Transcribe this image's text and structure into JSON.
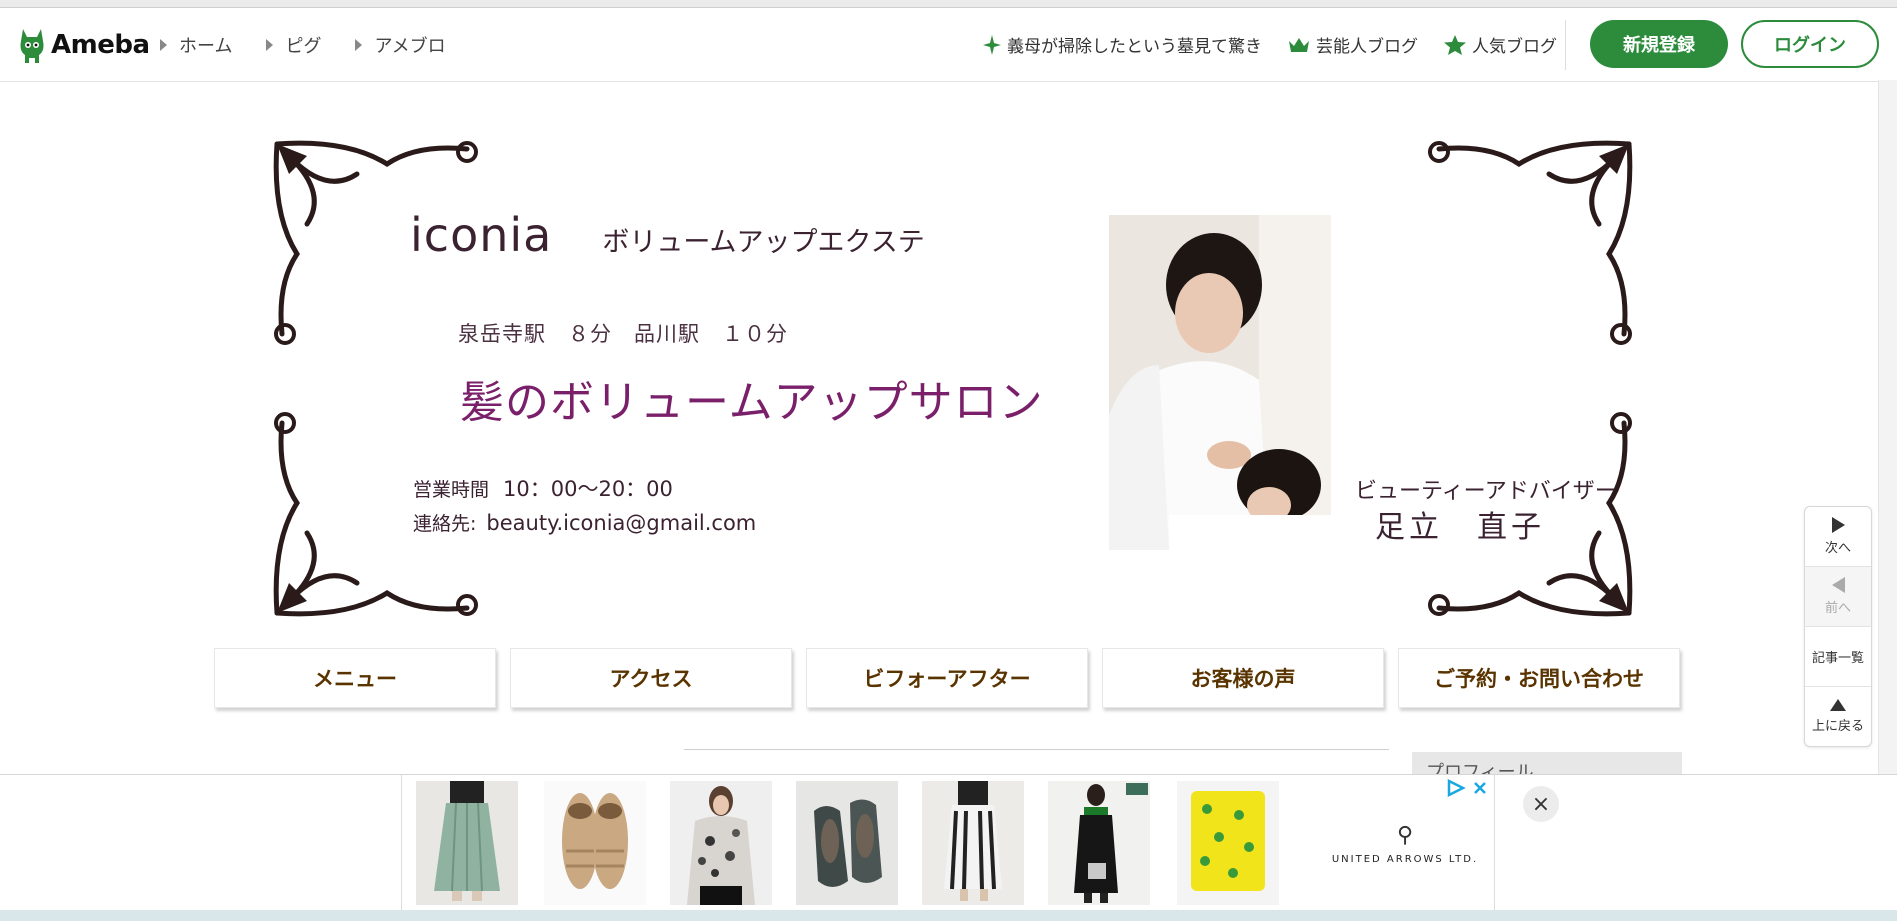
{
  "header": {
    "logo_text": "Ameba",
    "breadcrumbs": [
      "ホーム",
      "ピグ",
      "アメブロ"
    ],
    "links": [
      {
        "label": "義母が掃除したという墓見て驚き",
        "icon": "sparkle-icon"
      },
      {
        "label": "芸能人ブログ",
        "icon": "crown-icon"
      },
      {
        "label": "人気ブログ",
        "icon": "star-icon"
      }
    ],
    "signup_label": "新規登録",
    "login_label": "ログイン",
    "accent_color": "#2d8c3c"
  },
  "banner": {
    "salon_name": "iconia",
    "salon_sub": "ボリュームアップエクステ",
    "station": "泉岳寺駅　８分　品川駅　１０分",
    "catchphrase": "髪のボリュームアップサロン",
    "hours_label": "営業時間",
    "hours_value": "10：00〜20：00",
    "contact_label": "連絡先:",
    "contact_value": "beauty.iconia@gmail.com",
    "role": "ビューティーアドバイザー",
    "person_name": "足立　直子"
  },
  "nav_tabs": [
    "メニュー",
    "アクセス",
    "ビフォーアフター",
    "お客様の声",
    "ご予約・お問い合わせ"
  ],
  "sidebar": {
    "profile_heading": "プロフィール"
  },
  "side_nav": {
    "next_label": "次へ",
    "prev_label": "前へ",
    "list_label": "記事一覧",
    "top_label": "上に戻る"
  },
  "ad": {
    "brand_name": "UNITED ARROWS LTD.",
    "close_symbol": "×",
    "products": [
      "skirt",
      "shoes",
      "blouse",
      "flats",
      "striped-skirt",
      "dress",
      "pouch"
    ]
  }
}
